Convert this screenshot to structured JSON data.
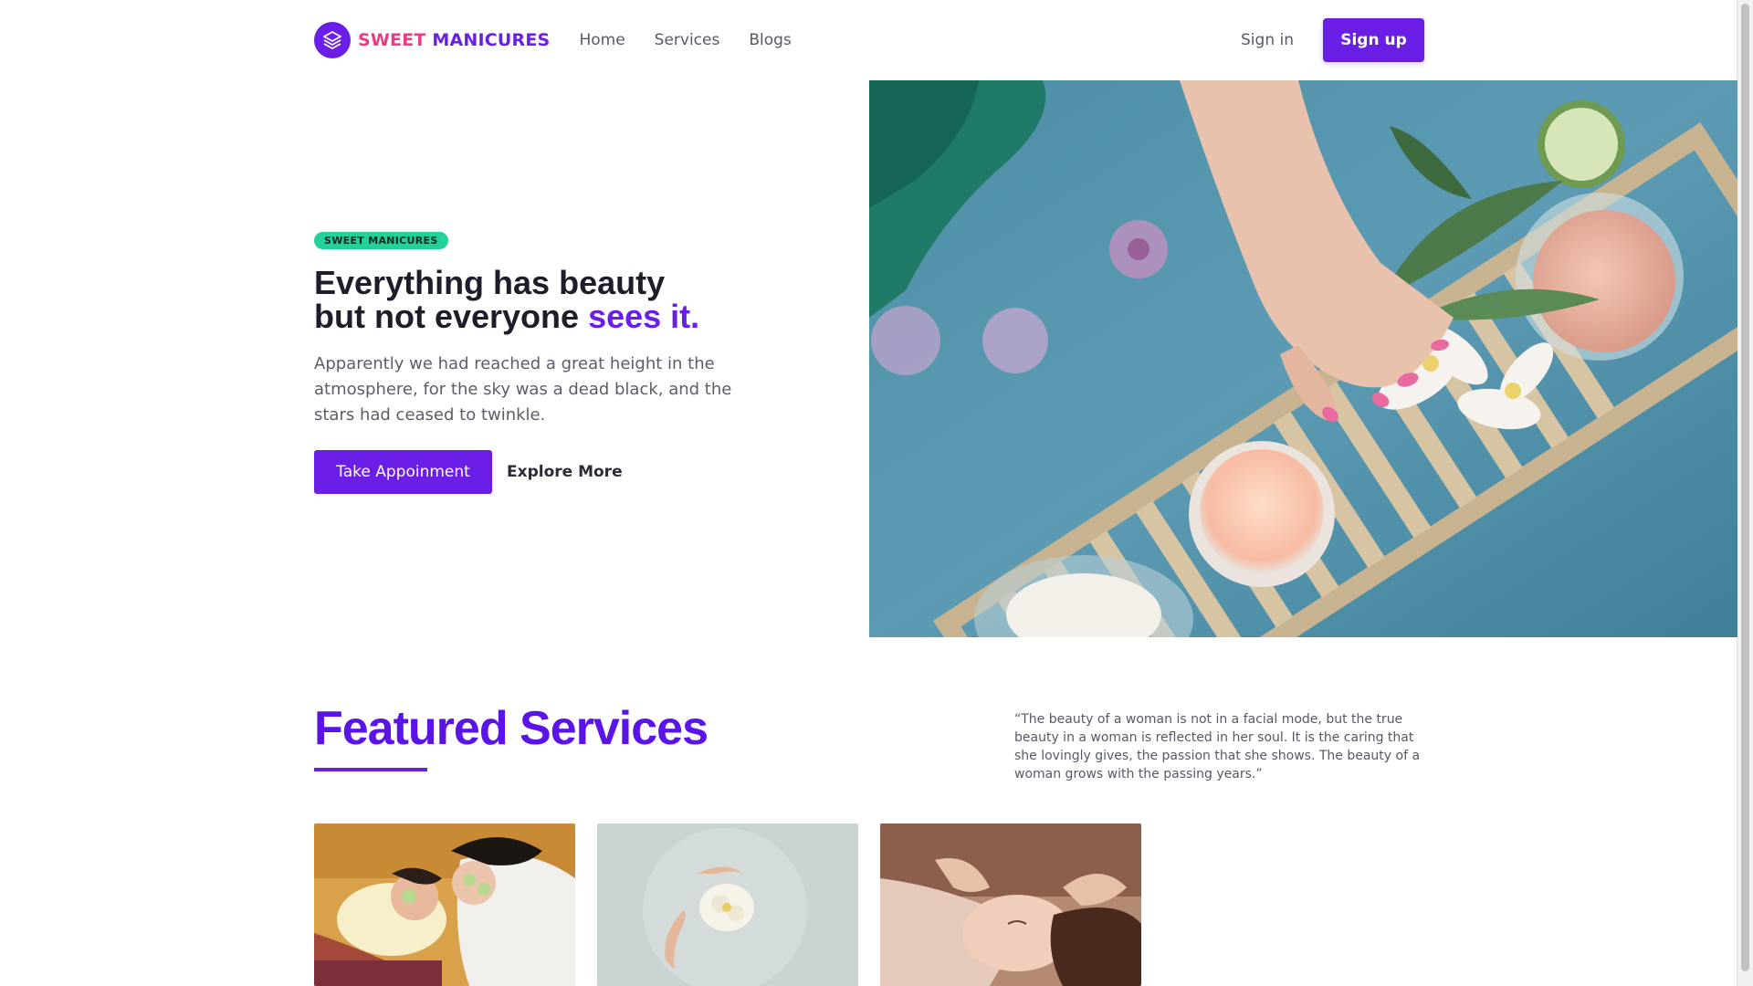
{
  "brand": {
    "name_part1": "SWEET",
    "name_part2": "MANICURES",
    "logo_icon": "layers-icon"
  },
  "nav": {
    "links": [
      "Home",
      "Services",
      "Blogs"
    ],
    "signin": "Sign in",
    "signup": "Sign up"
  },
  "hero": {
    "tag": "SWEET MANICURES",
    "title_line1": "Everything has beauty",
    "title_line2": "but not everyone",
    "title_accent": "sees it.",
    "text": "Apparently we had reached a great height in the atmosphere, for the sky was a dead black, and the stars had ceased to twinkle.",
    "primary_button": "Take Appoinment",
    "secondary_button": "Explore More"
  },
  "featured": {
    "title": "Featured Services",
    "quote": "“The beauty of a woman is not in a facial mode, but the true beauty in a woman is reflected in her soul. It is the caring that she lovingly gives, the passion that she shows. The beauty of a woman grows with the passing years.”"
  },
  "colors": {
    "accent": "#6a1ee6",
    "brand_pink": "#ec3b86",
    "tag_green": "#23d19a"
  }
}
